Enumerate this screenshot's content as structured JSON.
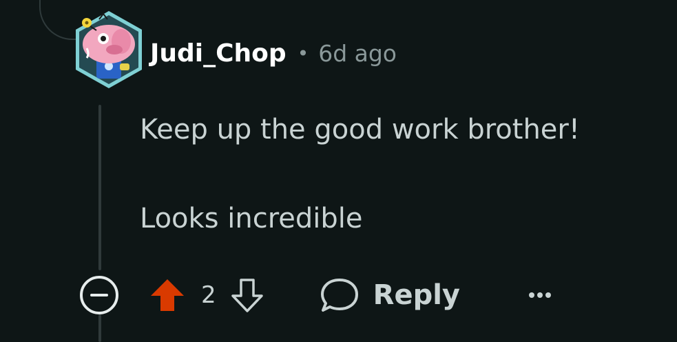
{
  "comment": {
    "author": "Judi_Chop",
    "separator": "•",
    "time": "6d ago",
    "lines": [
      "Keep up the good work brother!",
      "Looks incredible"
    ]
  },
  "actions": {
    "vote_count": "2",
    "reply_label": "Reply",
    "upvote_color": "#d93a00",
    "icon_color": "#c9d3d3"
  },
  "icons": [
    "collapse-icon",
    "upvote-arrow-icon",
    "downvote-arrow-icon",
    "reply-bubble-icon",
    "more-options-icon"
  ]
}
